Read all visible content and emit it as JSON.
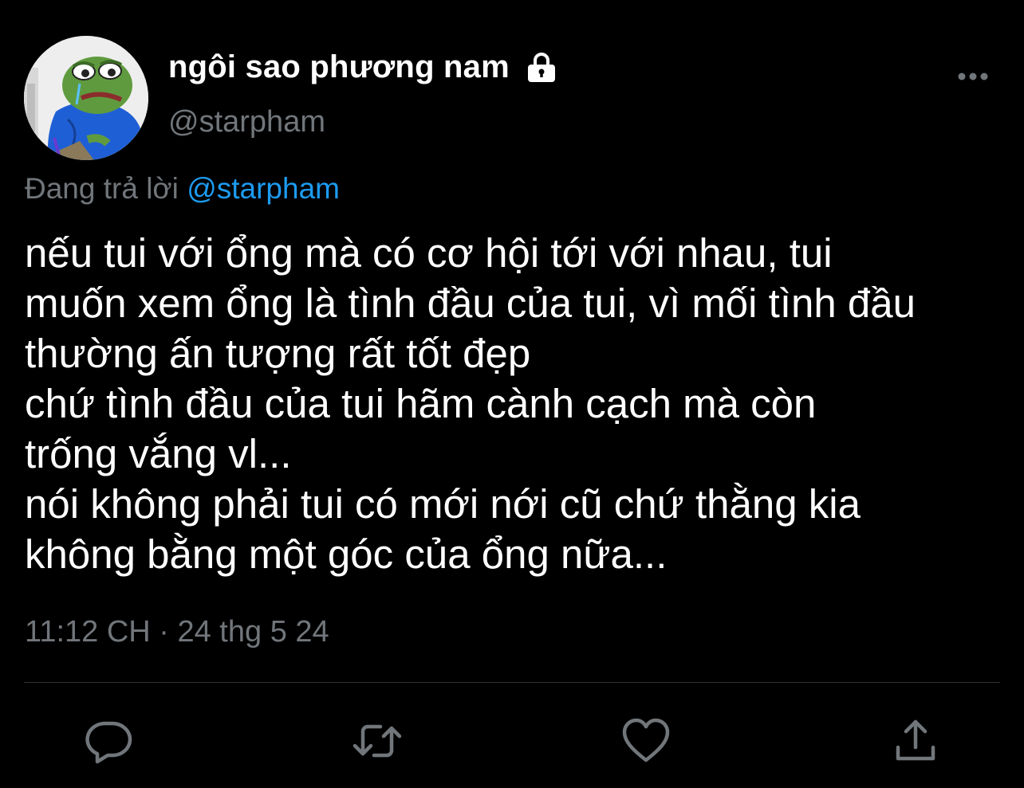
{
  "tweet": {
    "display_name": "ngôi sao phương nam",
    "handle": "@starpham",
    "reply_prefix": "Đang trả lời",
    "reply_mention": "@starpham",
    "text_lines": [
      "nếu tui với ổng mà có cơ hội tới với nhau, tui",
      "muốn xem ổng là tình đầu của tui, vì mối tình đầu",
      "thường ấn tượng rất tốt đẹp",
      "chứ tình đầu của tui hãm cành cạch mà còn",
      "trống vắng vl...",
      "nói không phải tui có mới nới cũ chứ thằng kia",
      "không bằng một góc của ổng nữa..."
    ],
    "timestamp": "11:12 CH · 24 thg 5 24"
  },
  "icons": {
    "lock": "lock-icon",
    "more": "more-icon",
    "reply": "reply-icon",
    "retweet": "retweet-icon",
    "like": "heart-icon",
    "share": "share-icon"
  },
  "colors": {
    "background": "#000000",
    "primary_text": "#ffffff",
    "secondary_text": "#71767b",
    "mention": "#1d9bf0",
    "divider": "#2f3336"
  }
}
